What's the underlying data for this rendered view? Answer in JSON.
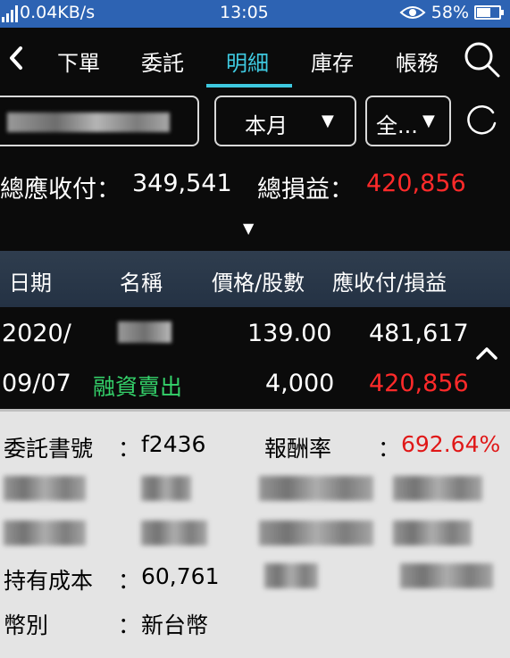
{
  "status_bar": {
    "network_speed": "0.04KB/s",
    "time": "13:05",
    "battery_percent": "58%",
    "icons": [
      "signal-icon",
      "eye-icon",
      "battery-icon"
    ]
  },
  "tabs": [
    {
      "label": "下單",
      "active": false
    },
    {
      "label": "委託",
      "active": false
    },
    {
      "label": "明細",
      "active": true
    },
    {
      "label": "庫存",
      "active": false
    },
    {
      "label": "帳務",
      "active": false
    }
  ],
  "filters": {
    "period": "本月",
    "category": "全..."
  },
  "totals": {
    "receivable_label": "總應收付：",
    "receivable_value": "349,541",
    "pnl_label": "總損益：",
    "pnl_value": "420,856"
  },
  "table": {
    "headers": [
      "日期",
      "名稱",
      "價格/股數",
      "應收付/損益"
    ],
    "rows": [
      {
        "date_line1": "2020/",
        "date_line2": "09/07",
        "type": "融資賣出",
        "price": "139.00",
        "shares": "4,000",
        "receivable": "481,617",
        "pnl": "420,856"
      }
    ]
  },
  "details": {
    "order_no_label": "委託書號",
    "order_no_sep": "：",
    "order_no_value": "f2436",
    "return_rate_label": "報酬率",
    "return_rate_sep": "：",
    "return_rate_value": "692.64%",
    "cost_label": "持有成本",
    "cost_sep": "：",
    "cost_value": "60,761",
    "currency_label": "幣別",
    "currency_sep": "：",
    "currency_value": "新台幣"
  },
  "colors": {
    "status_bar": "#2d63b3",
    "accent": "#3ec9e0",
    "loss_red": "#ff2a2a",
    "type_green": "#34d16a"
  }
}
